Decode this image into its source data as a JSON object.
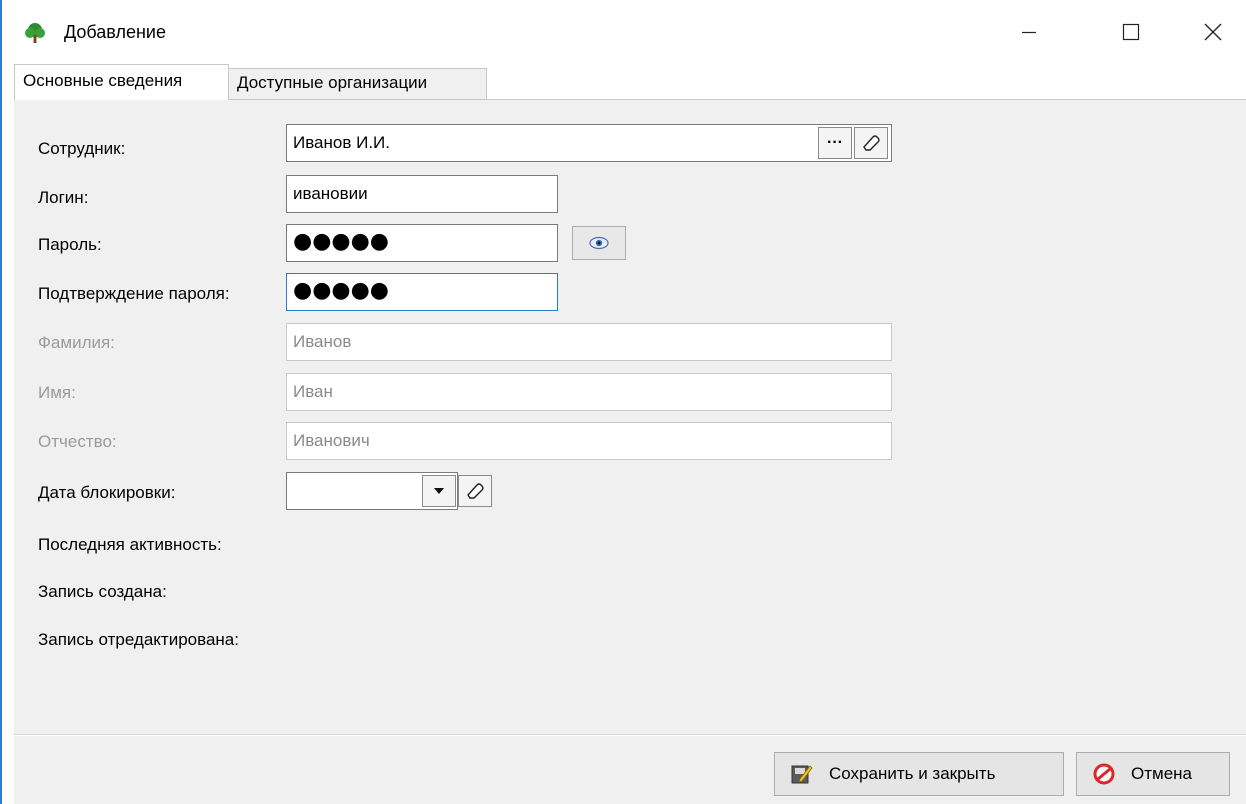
{
  "window": {
    "title": "Добавление",
    "icon": "tree-icon"
  },
  "tabs": [
    {
      "label": "Основные сведения",
      "active": true
    },
    {
      "label": "Доступные организации",
      "active": false
    }
  ],
  "form": {
    "employee": {
      "label": "Сотрудник:",
      "value": "Иванов И.И."
    },
    "login": {
      "label": "Логин:",
      "value": "ивановии"
    },
    "password": {
      "label": "Пароль:",
      "value": "●●●●●"
    },
    "password_confirm": {
      "label": "Подтверждение пароля:",
      "value": "●●●●●"
    },
    "last_name": {
      "label": "Фамилия:",
      "value": "Иванов"
    },
    "first_name": {
      "label": "Имя:",
      "value": "Иван"
    },
    "middle_name": {
      "label": "Отчество:",
      "value": "Иванович"
    },
    "block_date": {
      "label": "Дата блокировки:",
      "value": ""
    },
    "last_activity": {
      "label": "Последняя активность:"
    },
    "created": {
      "label": "Запись создана:"
    },
    "edited": {
      "label": "Запись отредактирована:"
    }
  },
  "buttons": {
    "save": "Сохранить и закрыть",
    "cancel": "Отмена"
  },
  "colors": {
    "accent": "#2b7cd3",
    "panel": "#f0f0f0",
    "disabled_text": "#9a9a9a"
  }
}
